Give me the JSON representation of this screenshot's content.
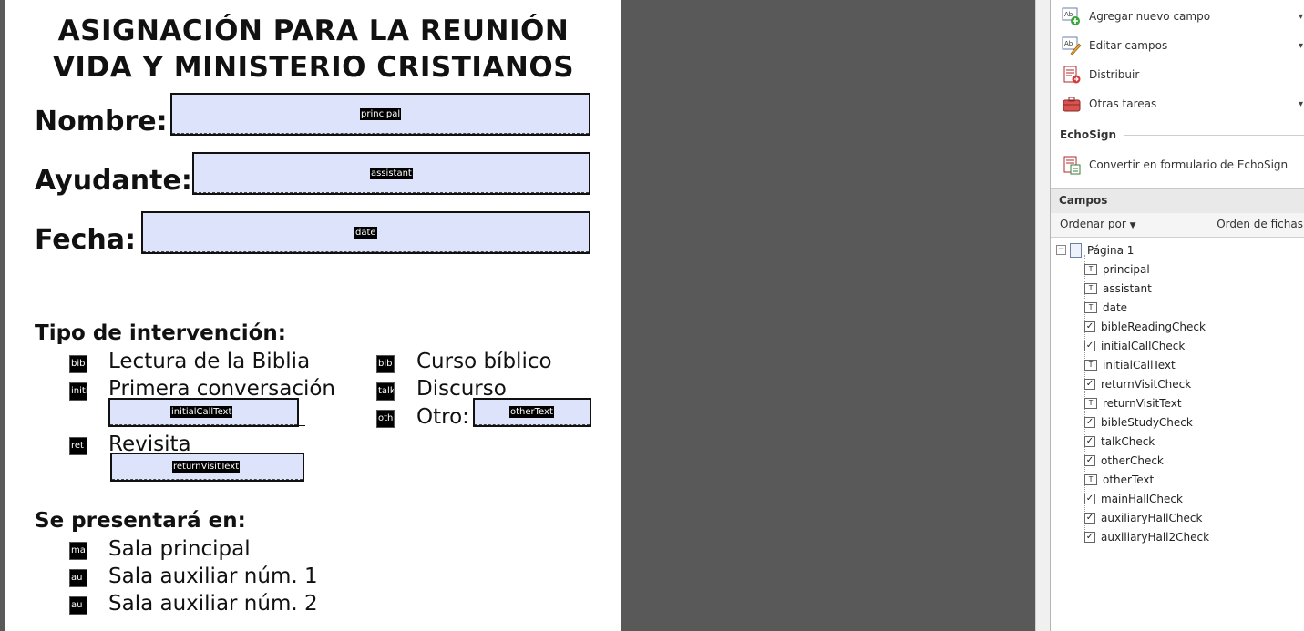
{
  "form": {
    "title_line1": "ASIGNACIÓN PARA LA REUNIÓN",
    "title_line2": "VIDA Y MINISTERIO CRISTIANOS",
    "name_label": "Nombre:",
    "assistant_label": "Ayudante:",
    "date_label": "Fecha:",
    "field_principal": "principal",
    "field_assistant": "assistant",
    "field_date": "date",
    "part_type_heading": "Tipo de intervención:",
    "opt_bible_reading": "Lectura de la Biblia",
    "opt_initial_call": "Primera conversación",
    "opt_return_visit": "Revisita",
    "opt_bible_study": "Curso bíblico",
    "opt_talk": "Discurso",
    "opt_other": "Otro:",
    "field_initial_call_text": "initialCallText",
    "field_return_visit_text": "returnVisitText",
    "field_other_text": "otherText",
    "chk_bible_reading": "bib",
    "chk_initial_call": "initi",
    "chk_return_visit": "ret",
    "chk_bible_study": "bib",
    "chk_talk": "talk",
    "chk_other": "oth",
    "presented_heading": "Se presentará en:",
    "opt_main_hall": "Sala principal",
    "opt_aux1": "Sala auxiliar núm. 1",
    "opt_aux2": "Sala auxiliar núm. 2",
    "chk_main_hall": "ma",
    "chk_aux1": "au",
    "chk_aux2": "au"
  },
  "panel": {
    "tasks": [
      {
        "label": "Agregar nuevo campo",
        "icon": "add-field-icon",
        "arrow": "▾"
      },
      {
        "label": "Editar campos",
        "icon": "edit-fields-icon",
        "arrow": "▾"
      },
      {
        "label": "Distribuir",
        "icon": "distribute-icon",
        "arrow": ""
      },
      {
        "label": "Otras tareas",
        "icon": "briefcase-icon",
        "arrow": "▾"
      }
    ],
    "echosign_heading": "EchoSign",
    "echosign_action": "Convertir en formulario de EchoSign",
    "campos_heading": "Campos",
    "sort_label": "Ordenar por",
    "tab_order_label": "Orden de fichas",
    "page_node": "Página 1",
    "fields": [
      {
        "name": "principal",
        "kind": "text"
      },
      {
        "name": "assistant",
        "kind": "text"
      },
      {
        "name": "date",
        "kind": "text"
      },
      {
        "name": "bibleReadingCheck",
        "kind": "check"
      },
      {
        "name": "initialCallCheck",
        "kind": "check"
      },
      {
        "name": "initialCallText",
        "kind": "text"
      },
      {
        "name": "returnVisitCheck",
        "kind": "check"
      },
      {
        "name": "returnVisitText",
        "kind": "text"
      },
      {
        "name": "bibleStudyCheck",
        "kind": "check"
      },
      {
        "name": "talkCheck",
        "kind": "check"
      },
      {
        "name": "otherCheck",
        "kind": "check"
      },
      {
        "name": "otherText",
        "kind": "text"
      },
      {
        "name": "mainHallCheck",
        "kind": "check"
      },
      {
        "name": "auxiliaryHallCheck",
        "kind": "check"
      },
      {
        "name": "auxiliaryHall2Check",
        "kind": "check"
      }
    ]
  },
  "colors": {
    "field_fill": "#dde3fb",
    "viewer_gray": "#595959"
  }
}
